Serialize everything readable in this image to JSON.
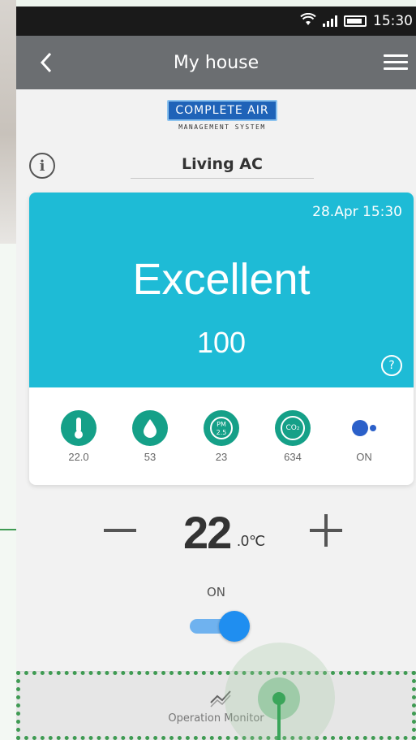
{
  "status_bar": {
    "time": "15:30"
  },
  "app_bar": {
    "title": "My house"
  },
  "logo": {
    "brand": "COMPLETE AIR",
    "subtitle": "MANAGEMENT SYSTEM"
  },
  "device": {
    "name": "Living AC"
  },
  "air_quality": {
    "datetime": "28.Apr 15:30",
    "status": "Excellent",
    "score": "100",
    "background_color": "#1ebbd6"
  },
  "sensors": [
    {
      "icon": "thermometer-icon",
      "value": "22.0"
    },
    {
      "icon": "humidity-drop-icon",
      "value": "53"
    },
    {
      "icon": "pm25-icon",
      "value": "23",
      "icon_text_top": "PM",
      "icon_text_bottom": "2.5"
    },
    {
      "icon": "co2-icon",
      "value": "634",
      "icon_text": "CO₂"
    },
    {
      "icon": "purifier-icon",
      "value": "ON"
    }
  ],
  "temperature": {
    "value": "22",
    "decimal_unit": ".0℃"
  },
  "power": {
    "label": "ON",
    "state": "on"
  },
  "bottom_nav": {
    "label": "Operation Monitor"
  },
  "colors": {
    "accent_teal": "#15a088",
    "toggle_blue": "#1f8ef0",
    "highlight_green": "#3f9b53"
  }
}
